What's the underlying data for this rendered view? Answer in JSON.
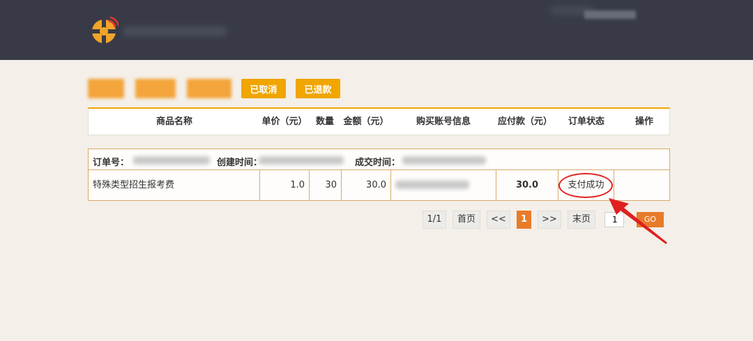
{
  "tabs": [
    {
      "label": "",
      "blurred": true
    },
    {
      "label": "",
      "blurred": true
    },
    {
      "label": "",
      "blurred": true
    },
    {
      "label": "已取消",
      "blurred": false
    },
    {
      "label": "已退款",
      "blurred": false
    }
  ],
  "table": {
    "headers": [
      "商品名称",
      "单价（元）",
      "数量",
      "金额（元）",
      "购买账号信息",
      "应付款（元）",
      "订单状态",
      "操作"
    ]
  },
  "order": {
    "order_no_label": "订单号：",
    "created_label": "创建时间：",
    "deal_label": "成交时间：",
    "product_name": "特殊类型招生报考费",
    "unit_price": "1.0",
    "quantity": "30",
    "amount": "30.0",
    "payable": "30.0",
    "status": "支付成功"
  },
  "pagination": {
    "page_info": "1/1",
    "first": "首页",
    "prev": "<<",
    "current": "1",
    "next": ">>",
    "last": "末页",
    "input_value": "1",
    "go": "GO"
  },
  "colors": {
    "topbar": "#383b47",
    "accent": "#f0a500",
    "pager_active": "#e87b2a",
    "annotation": "#e02020"
  }
}
